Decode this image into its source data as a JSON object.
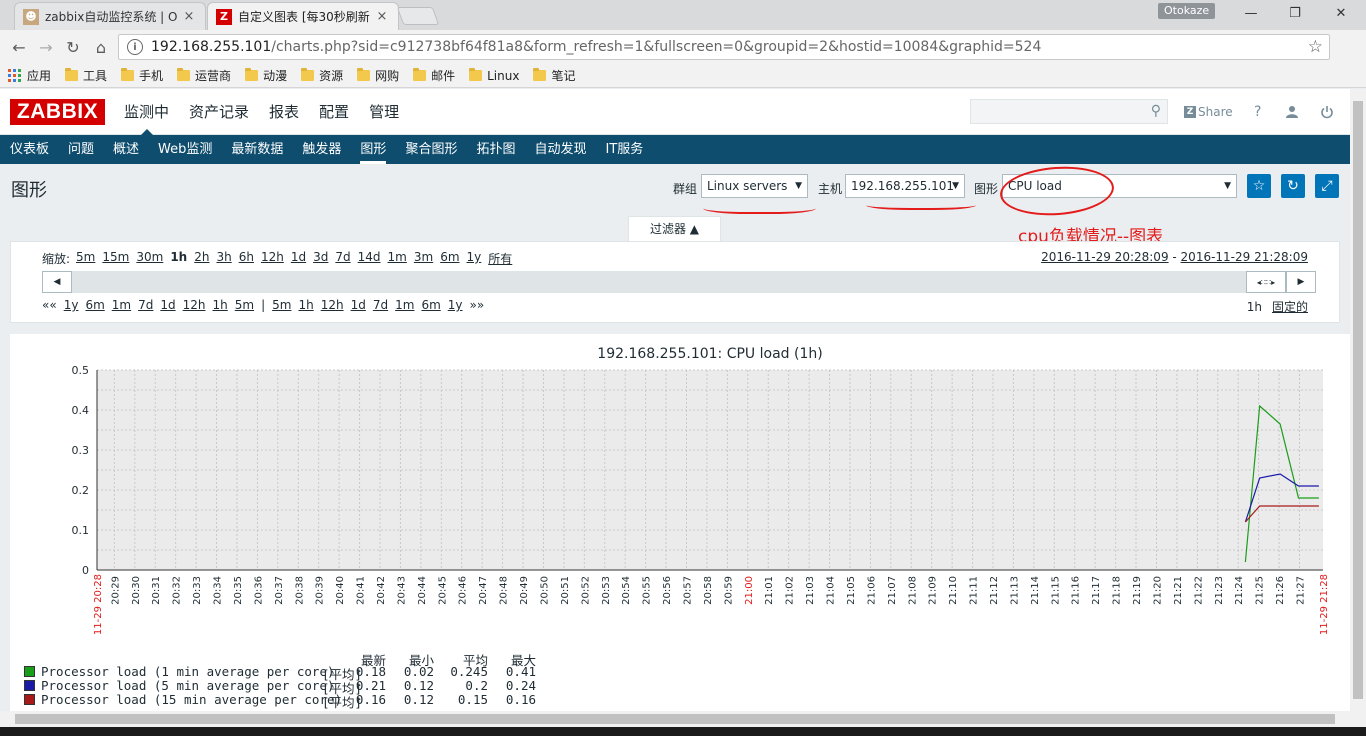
{
  "browser": {
    "tabs": [
      {
        "title": "zabbix自动监控系统 | O"
      },
      {
        "title": "自定义图表 [每30秒刷新"
      }
    ],
    "profile_name": "Otokaze",
    "url_host": "192.168.255.101",
    "url_path": "/charts.php?sid=c912738bf64f81a8&form_refresh=1&fullscreen=0&groupid=2&hostid=10084&graphid=524",
    "bookmarks": [
      "应用",
      "工具",
      "手机",
      "运营商",
      "动漫",
      "资源",
      "网购",
      "邮件",
      "Linux",
      "笔记"
    ]
  },
  "header": {
    "logo": "ZABBIX",
    "topnav": [
      "监测中",
      "资产记录",
      "报表",
      "配置",
      "管理"
    ],
    "share_label": "Share",
    "help_label": "?"
  },
  "subnav": [
    "仪表板",
    "问题",
    "概述",
    "Web监测",
    "最新数据",
    "触发器",
    "图形",
    "聚合图形",
    "拓扑图",
    "自动发现",
    "IT服务"
  ],
  "page": {
    "title": "图形",
    "group_label": "群组",
    "group_value": "Linux servers",
    "host_label": "主机",
    "host_value": "192.168.255.101",
    "graph_label": "图形",
    "graph_value": "CPU load",
    "annotation": "cpu负载情况--图表"
  },
  "filter": {
    "tab_label": "过滤器 ▲",
    "zoom_label": "缩放:",
    "zoom_options": [
      "5m",
      "15m",
      "30m",
      "1h",
      "2h",
      "3h",
      "6h",
      "12h",
      "1d",
      "3d",
      "7d",
      "14d",
      "1m",
      "3m",
      "6m",
      "1y",
      "所有"
    ],
    "zoom_current": "1h",
    "period_from": "2016-11-29 20:28:09",
    "period_sep": " - ",
    "period_to": "2016-11-29 21:28:09",
    "nav_back": [
      "««",
      "1y",
      "6m",
      "1m",
      "7d",
      "1d",
      "12h",
      "1h",
      "5m",
      "|",
      "5m",
      "1h",
      "12h",
      "1d",
      "7d",
      "1m",
      "6m",
      "1y",
      "»»"
    ],
    "period_len": "1h",
    "fixed_label": "固定的"
  },
  "chart_data": {
    "type": "line",
    "title": "192.168.255.101: CPU load (1h)",
    "ylim": [
      0,
      0.5
    ],
    "yticks": [
      "0.5",
      "0.4",
      "0.3",
      "0.2",
      "0.1",
      "0"
    ],
    "x_start_label": "11-29 20:28",
    "x_end_label": "11-29 21:28",
    "x_ticks": [
      "20:29",
      "20:30",
      "20:31",
      "20:32",
      "20:33",
      "20:34",
      "20:35",
      "20:36",
      "20:37",
      "20:38",
      "20:39",
      "20:40",
      "20:41",
      "20:42",
      "20:43",
      "20:44",
      "20:45",
      "20:46",
      "20:47",
      "20:48",
      "20:49",
      "20:50",
      "20:51",
      "20:52",
      "20:53",
      "20:54",
      "20:55",
      "20:56",
      "20:57",
      "20:58",
      "20:59",
      "21:00",
      "21:01",
      "21:02",
      "21:03",
      "21:04",
      "21:05",
      "21:06",
      "21:07",
      "21:08",
      "21:09",
      "21:10",
      "21:11",
      "21:12",
      "21:13",
      "21:14",
      "21:15",
      "21:16",
      "21:17",
      "21:18",
      "21:19",
      "21:20",
      "21:21",
      "21:22",
      "21:23",
      "21:24",
      "21:25",
      "21:26",
      "21:27"
    ],
    "x_highlight": "21:00",
    "series": [
      {
        "name": "Processor load (1 min average per core)",
        "color": "#1a9e1a",
        "x": [
          "21:24.4",
          "21:25.1",
          "21:26.1",
          "21:27",
          "21:28"
        ],
        "x_min": [
          1236.4,
          1245.1,
          1246.1,
          1247,
          1248
        ],
        "y": [
          0.02,
          0.41,
          0.365,
          0.18,
          0.18
        ],
        "last": "0.18",
        "min": "0.02",
        "avg": "0.245",
        "max": "0.41"
      },
      {
        "name": "Processor load (5 min average per core)",
        "color": "#1a1aa8",
        "x_min": [
          1236.4,
          1245.1,
          1246.1,
          1247,
          1248
        ],
        "y": [
          0.12,
          0.23,
          0.24,
          0.21,
          0.21
        ],
        "last": "0.21",
        "min": "0.12",
        "avg": "0.2",
        "max": "0.24"
      },
      {
        "name": "Processor load (15 min average per core)",
        "color": "#a81a1a",
        "x_min": [
          1236.4,
          1245.1,
          1246.1,
          1247,
          1248
        ],
        "y": [
          0.12,
          0.16,
          0.16,
          0.16,
          0.16
        ],
        "last": "0.16",
        "min": "0.12",
        "avg": "0.15",
        "max": "0.16"
      }
    ],
    "legend_headers": [
      "最新",
      "最小",
      "平均",
      "最大"
    ],
    "legend_func": "[平均]",
    "grid": true
  }
}
